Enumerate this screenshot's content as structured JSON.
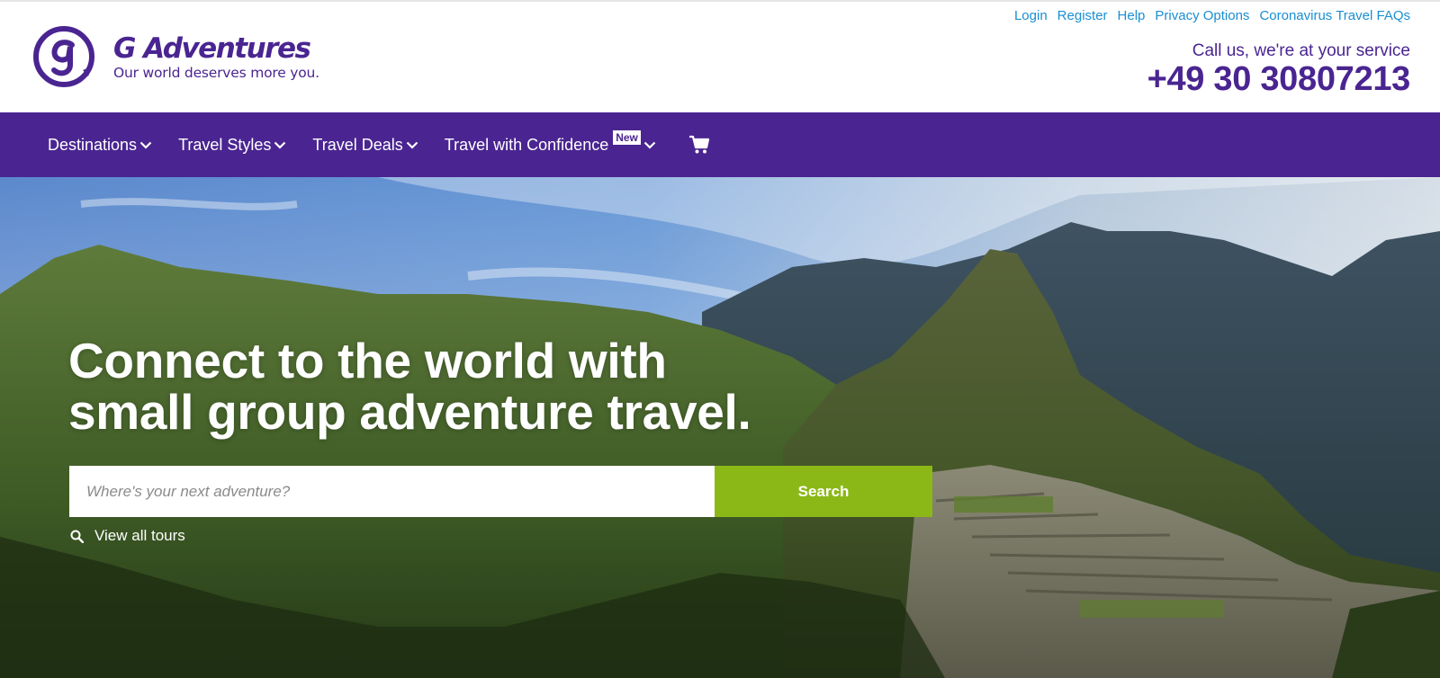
{
  "brand": {
    "name": "G Adventures",
    "tagline": "Our world deserves more you.",
    "colors": {
      "primary": "#4a2591",
      "link": "#1a8fd1",
      "accent": "#8cb817"
    }
  },
  "util_links": [
    "Login",
    "Register",
    "Help",
    "Privacy Options",
    "Coronavirus Travel FAQs"
  ],
  "callus": {
    "label": "Call us, we're at your service",
    "number": "+49 30 30807213"
  },
  "nav": {
    "items": [
      {
        "label": "Destinations"
      },
      {
        "label": "Travel Styles"
      },
      {
        "label": "Travel Deals"
      },
      {
        "label": "Travel with Confidence",
        "badge": "New"
      }
    ],
    "cart_icon": "shopping-cart-icon"
  },
  "hero": {
    "headline_line1": "Connect to the world with",
    "headline_line2": "small group adventure travel.",
    "search_placeholder": "Where's your next adventure?",
    "search_button": "Search",
    "view_all": "View all tours"
  }
}
